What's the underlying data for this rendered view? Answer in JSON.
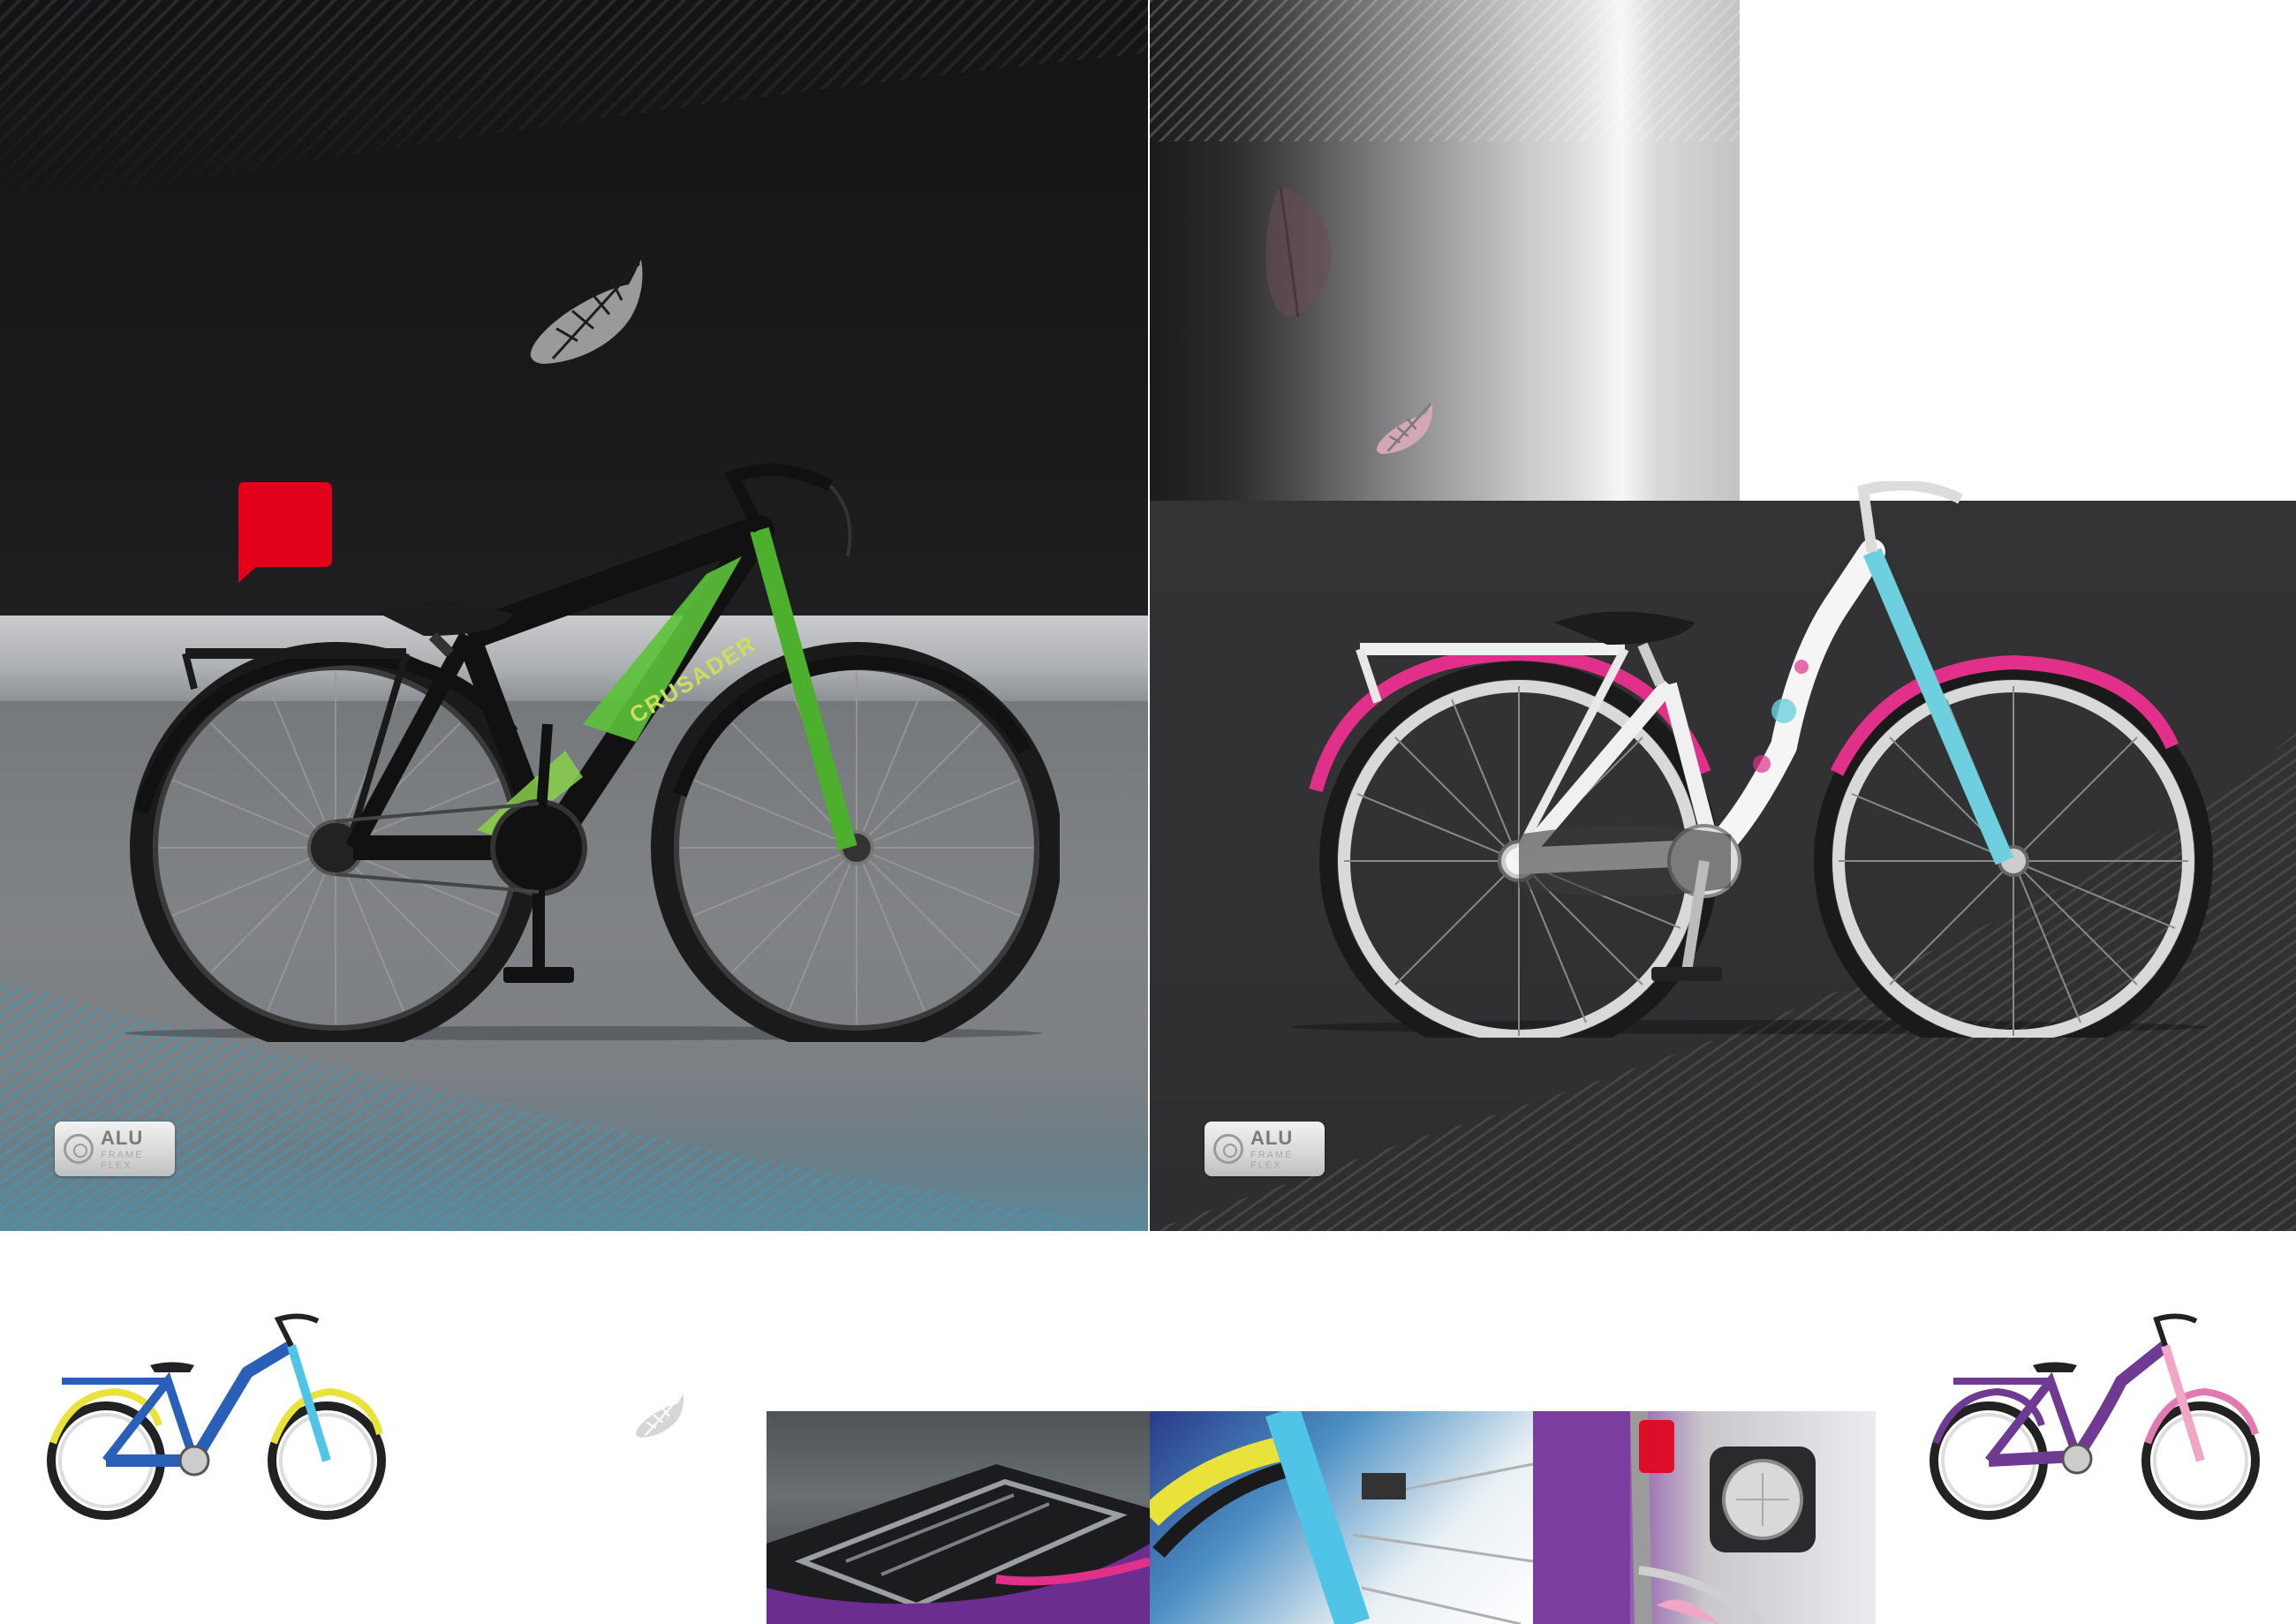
{
  "left_bike": {
    "frame_text": "CRUSADER"
  },
  "badges": {
    "left": {
      "main": "ALU",
      "line1": "FRAME",
      "line2": "FLEX"
    },
    "right": {
      "main": "ALU",
      "line1": "FRAME",
      "line2": "FLEX"
    }
  },
  "icons": {
    "feather": "feather-icon",
    "speech": "speech-bubble-icon",
    "alu_logo": "alu-frame-flex-logo"
  },
  "colors": {
    "accent_red": "#e3001b",
    "left_bike_green": "#5cc33a",
    "right_bike_pink": "#e0308a",
    "right_bike_cyan": "#6ed0df",
    "bottom_left_bike_blue": "#2a5fb8",
    "bottom_right_bike_purple": "#6e3a92"
  }
}
